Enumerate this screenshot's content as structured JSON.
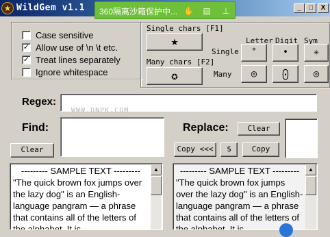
{
  "window": {
    "title": "WildGem v1.1",
    "icon": "star-emblem-icon",
    "minimize": "_",
    "maximize": "□",
    "close": "X"
  },
  "sandbox_badge": {
    "text": "360隔离沙箱保护中...",
    "icons": [
      "hand-icon",
      "folder-icon",
      "pin-icon"
    ]
  },
  "options": {
    "items": [
      {
        "label": "Case sensitive",
        "checked": false,
        "mark": ""
      },
      {
        "label": "Allow use of \\n \\t etc.",
        "checked": true,
        "mark": "✓"
      },
      {
        "label": "Treat lines separately",
        "checked": true,
        "mark": "✓"
      },
      {
        "label": "Ignore whitespace",
        "checked": false,
        "mark": ""
      }
    ]
  },
  "wildcards": {
    "single_header": "Single chars [F1]",
    "single_symbol": "★",
    "many_header": "Many chars [F2]",
    "many_symbol": "✪",
    "col_letter": "Letter",
    "col_digit": "Digit",
    "col_sym": "Sym",
    "row_single": "Single",
    "row_many": "Many",
    "single_letter": "°",
    "single_digit": "•",
    "single_sym": "✳",
    "many_letter": "◎",
    "many_digit": "⨀",
    "many_sym": "◎"
  },
  "regex": {
    "label": "Regex:",
    "value": ""
  },
  "watermark": "WWW.ONPK.COM",
  "find": {
    "label": "Find:",
    "value": "",
    "clear_label": "Clear"
  },
  "replace": {
    "label": "Replace:",
    "value": "",
    "clear_label": "Clear"
  },
  "copy_buttons": {
    "copy_back": "Copy <<<",
    "dollar": "$",
    "copy": "Copy"
  },
  "sample_left": {
    "header": "---------  SAMPLE TEXT  ---------",
    "body": "\"The quick brown fox jumps over the lazy dog\" is an English-language pangram — a phrase that contains all of the letters of the alphabet. It is"
  },
  "sample_right": {
    "header": "---------  SAMPLE TEXT  ---------",
    "body": "\"The quick brown fox jumps over the lazy dog\" is an English-language pangram — a phrase that contains all of the letters of the alphabet. It is"
  },
  "colors": {
    "titlebar_start": "#0a246a",
    "badge": "#6fbf3a",
    "face": "#d4d0c8"
  }
}
